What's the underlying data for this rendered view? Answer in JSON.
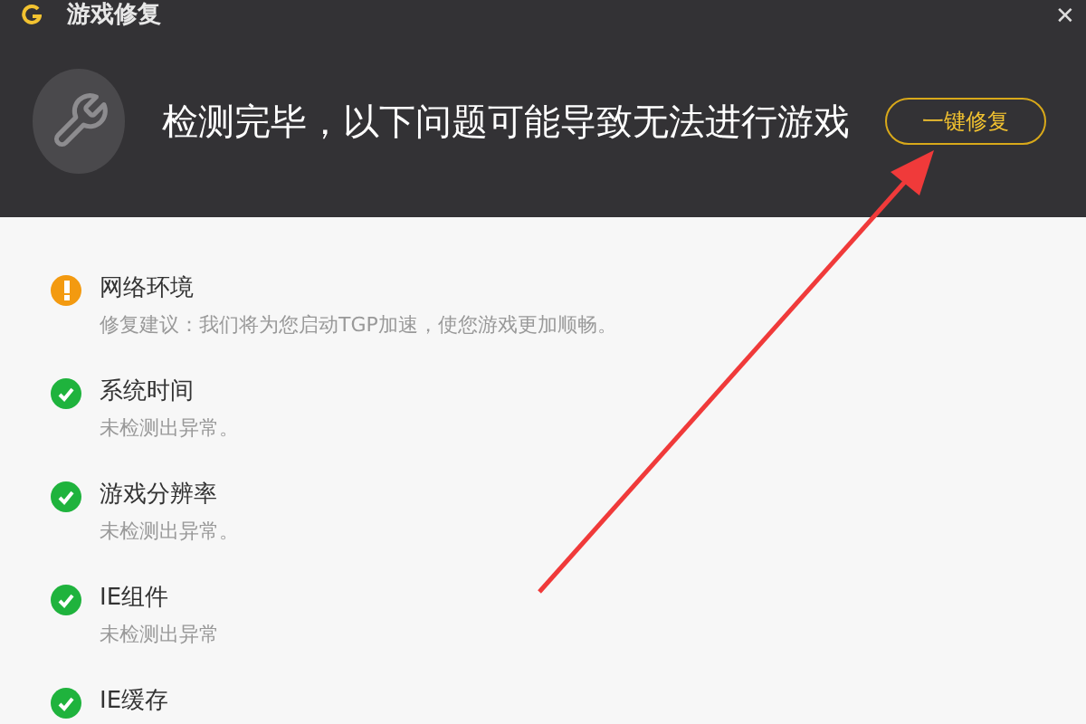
{
  "window": {
    "title": "游戏修复",
    "close": "✕"
  },
  "header": {
    "message": "检测完毕，以下问题可能导致无法进行游戏",
    "button": "一键修复"
  },
  "items": [
    {
      "kind": "warning",
      "title": "网络环境",
      "detail": "修复建议：我们将为您启动TGP加速，使您游戏更加顺畅。"
    },
    {
      "kind": "ok",
      "title": "系统时间",
      "detail": "未检测出异常。"
    },
    {
      "kind": "ok",
      "title": "游戏分辨率",
      "detail": "未检测出异常。"
    },
    {
      "kind": "ok",
      "title": "IE组件",
      "detail": "未检测出异常"
    },
    {
      "kind": "ok",
      "title": "IE缓存"
    }
  ]
}
